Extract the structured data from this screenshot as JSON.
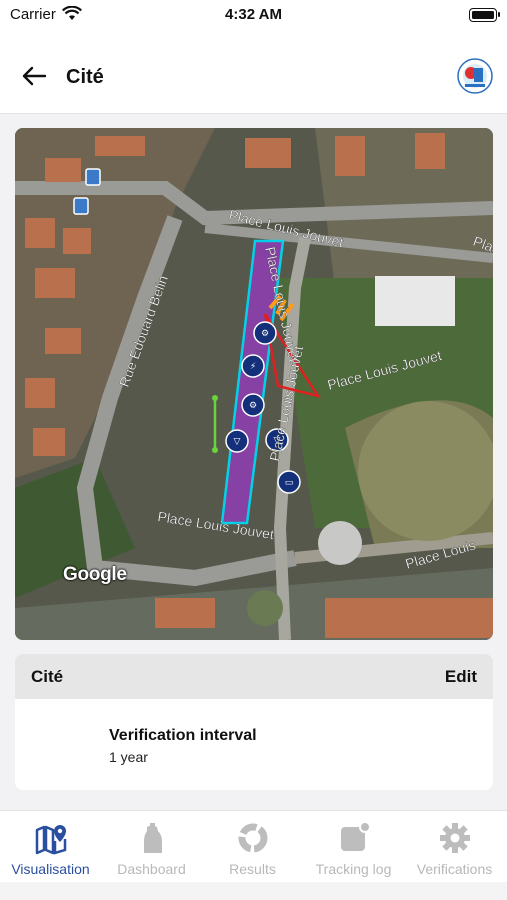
{
  "status_bar": {
    "carrier": "Carrier",
    "time": "4:32 AM"
  },
  "header": {
    "title": "Cité"
  },
  "map": {
    "attribution": "Google",
    "street_labels": [
      "Place Louis Jouvet",
      "Place Louis Jouvet",
      "Place Louis Jouvet",
      "Place Louis Jouvet",
      "Place Louis Jouvet",
      "Rue Edouard Belin",
      "Place Louis",
      "Place"
    ]
  },
  "info_card": {
    "title": "Cité",
    "edit_label": "Edit",
    "field_label": "Verification interval",
    "field_value": "1 year"
  },
  "tabs": [
    {
      "label": "Visualisation",
      "icon": "map-pin-icon",
      "active": true
    },
    {
      "label": "Dashboard",
      "icon": "fire-extinguisher-icon",
      "active": false
    },
    {
      "label": "Results",
      "icon": "donut-chart-icon",
      "active": false
    },
    {
      "label": "Tracking log",
      "icon": "notification-square-icon",
      "active": false
    },
    {
      "label": "Verifications",
      "icon": "gear-icon",
      "active": false
    }
  ],
  "colors": {
    "accent": "#2a4fa0",
    "inactive": "#b8b8b8",
    "building_outline": "#00d8f0",
    "building_fill": "#8a3fa8"
  }
}
